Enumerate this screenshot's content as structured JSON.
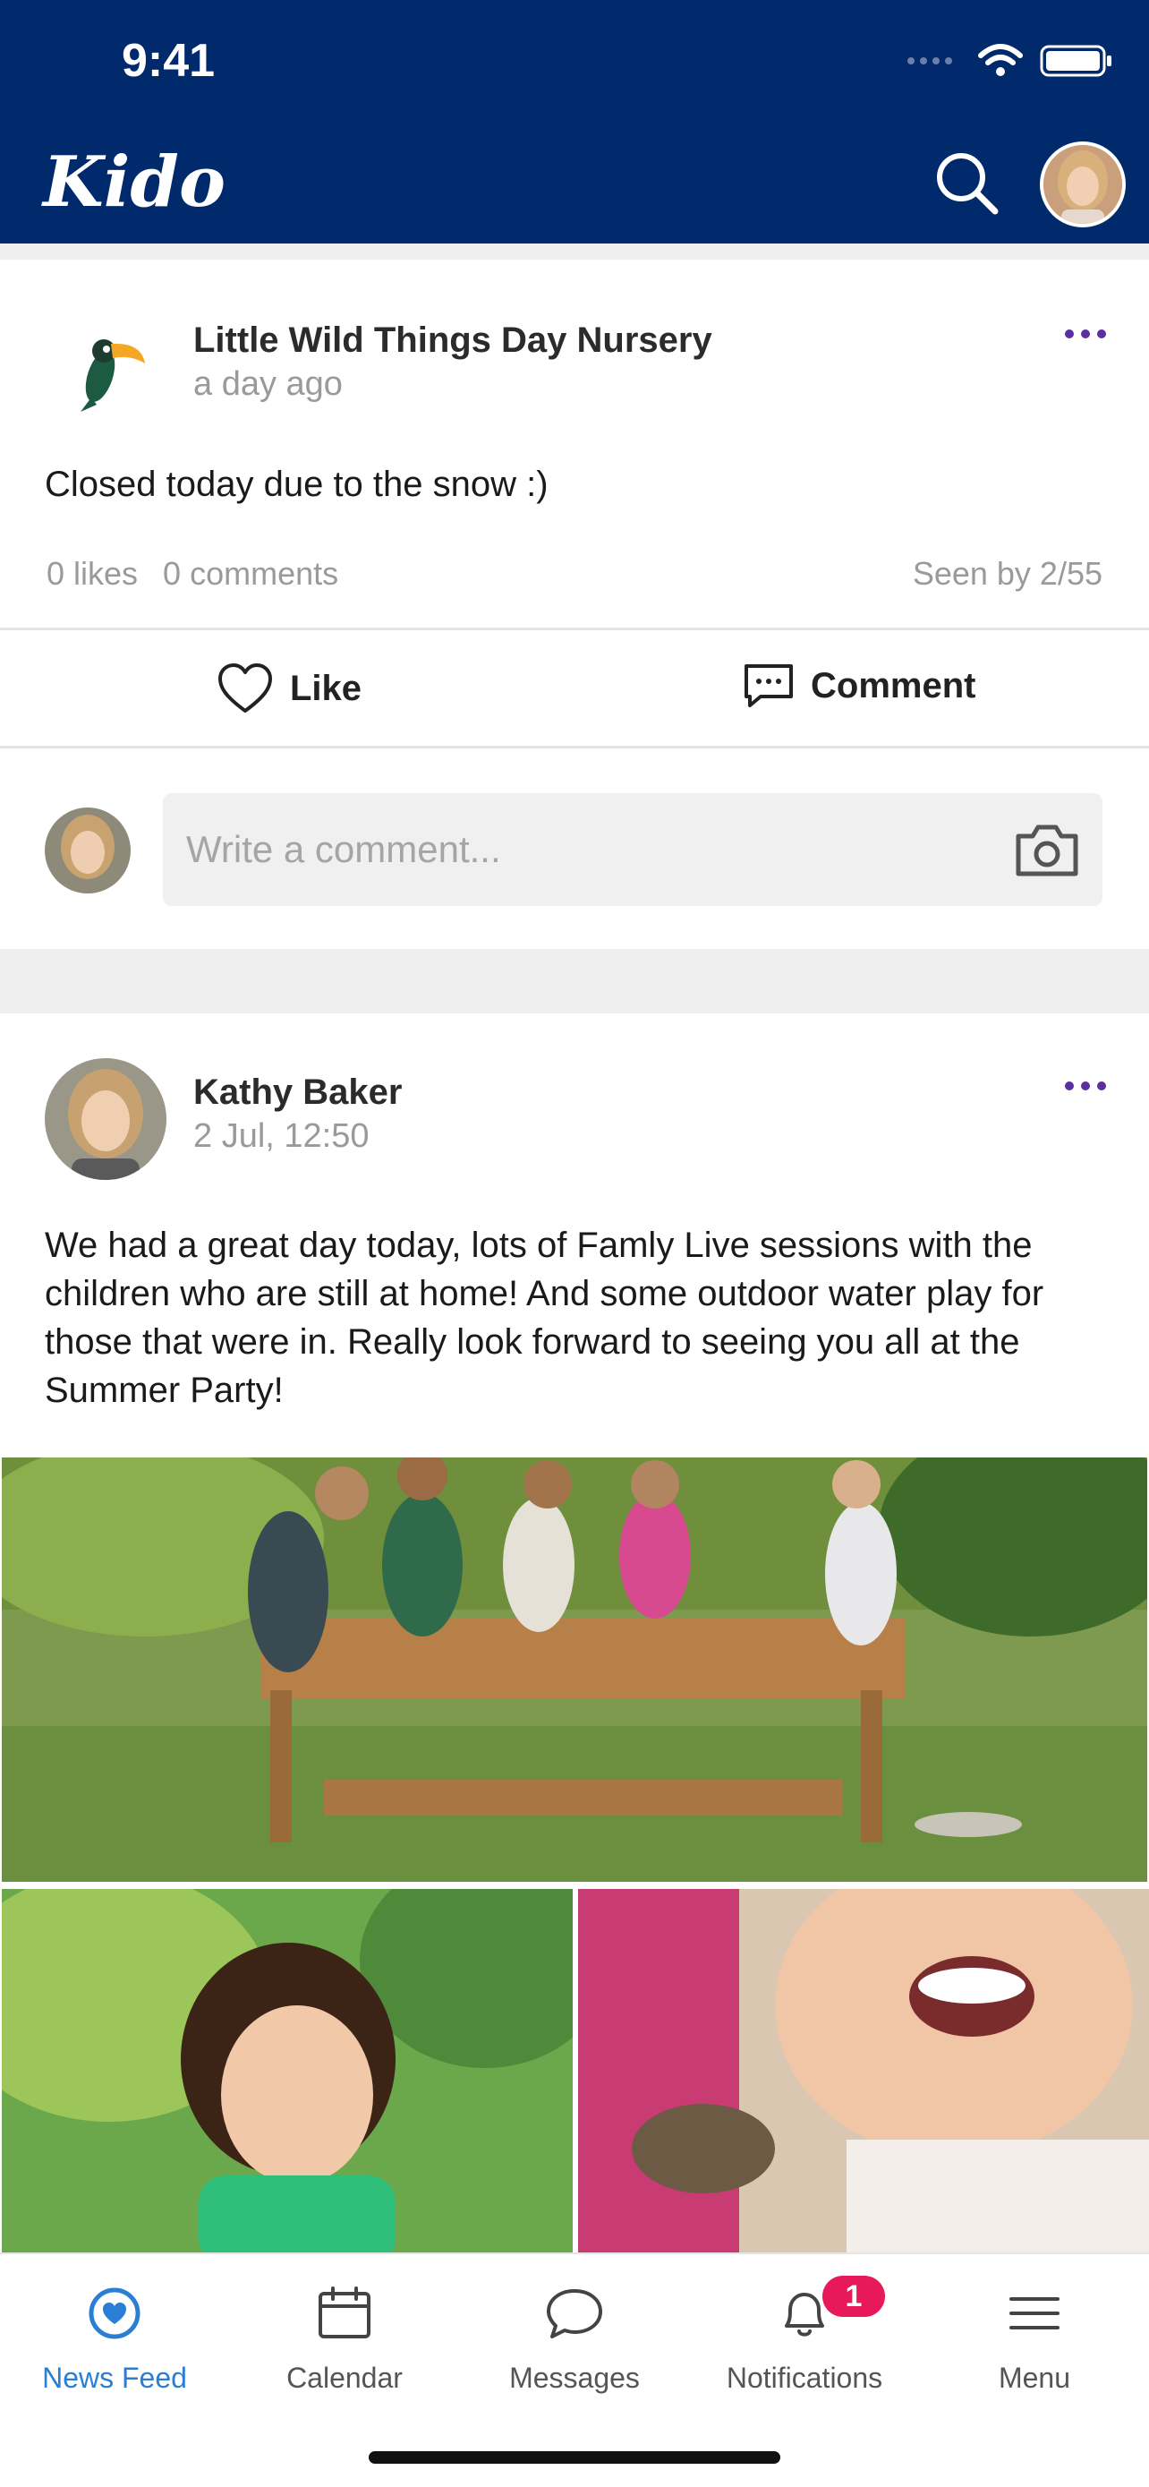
{
  "status_bar": {
    "time": "9:41"
  },
  "header": {
    "logo": "Kido"
  },
  "posts": [
    {
      "author": "Little Wild Things Day Nursery",
      "time": "a day ago",
      "text": "Closed today due to the snow :)",
      "likes": "0 likes",
      "comments": "0 comments",
      "seen": "Seen by 2/55",
      "like_label": "Like",
      "comment_label": "Comment",
      "comment_placeholder": "Write a comment..."
    },
    {
      "author": "Kathy Baker",
      "time": "2 Jul, 12:50",
      "text": "We had a great day today, lots of Famly Live sessions with the children who are still at home! And some outdoor water play for those that were in. Really look forward to seeing you all at the Summer Party!"
    }
  ],
  "tabs": [
    {
      "label": "News Feed",
      "icon": "heart-circle-icon",
      "active": true
    },
    {
      "label": "Calendar",
      "icon": "calendar-icon"
    },
    {
      "label": "Messages",
      "icon": "chat-bubble-icon"
    },
    {
      "label": "Notifications",
      "icon": "bell-icon",
      "badge": "1"
    },
    {
      "label": "Menu",
      "icon": "hamburger-icon"
    }
  ],
  "colors": {
    "header_bg": "#002a6b",
    "accent": "#2a7fd4",
    "badge": "#e8195b",
    "more_dots": "#5b2fa0"
  }
}
